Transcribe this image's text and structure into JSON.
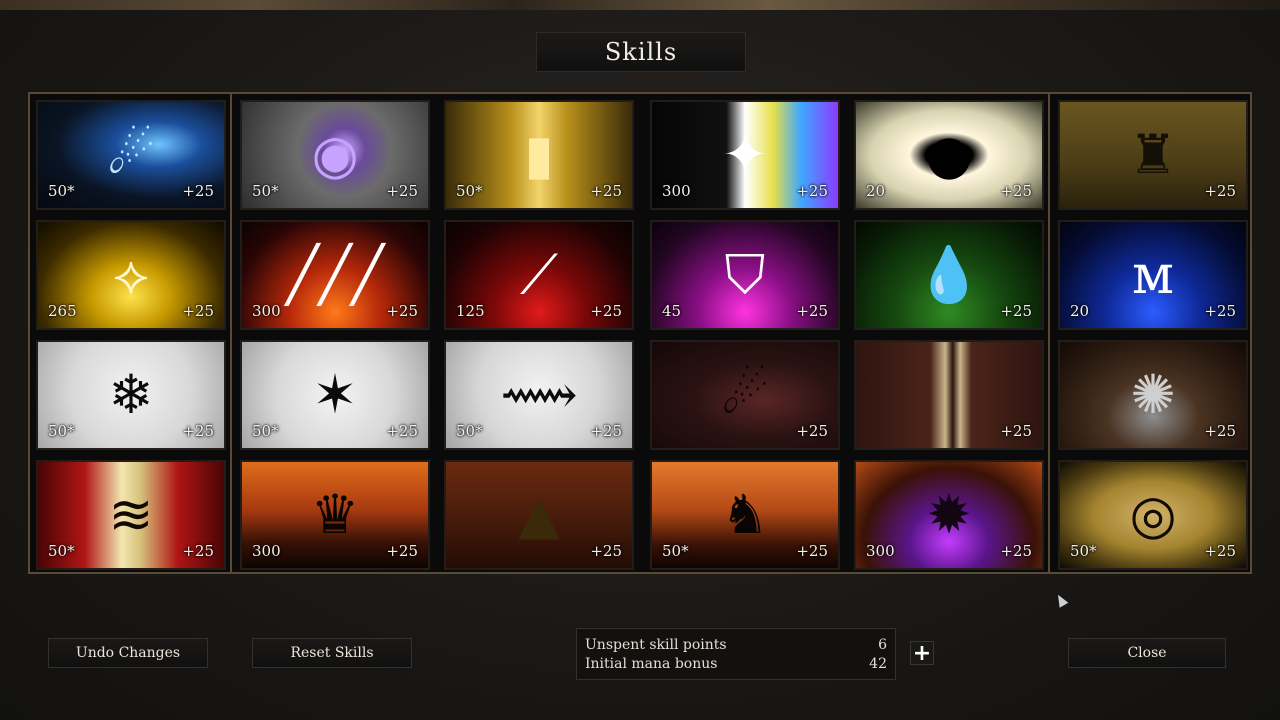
{
  "title": "Skills",
  "skills": [
    {
      "id": "r1c1",
      "cost": "50*",
      "bonus": "+25",
      "icon": "blue-comet-icon",
      "bg": "radial-gradient(ellipse at 65% 40%, #6fc4ff 0%, #1b4f9c 25%, #0a1424 60%, #05080f 100%)",
      "glyph": "☄",
      "glyphColor": "#bfe6ff"
    },
    {
      "id": "r1c2",
      "cost": "50*",
      "bonus": "+25",
      "icon": "crystal-orb-forest-icon",
      "bg": "radial-gradient(circle at 55% 45%, #c9a6ff 0%, #6a4a9c 18%, #6b6b6b 40%, #2e2e2e 100%)",
      "glyph": "◉",
      "glyphColor": "#c7a2ff"
    },
    {
      "id": "r1c3",
      "cost": "50*",
      "bonus": "+25",
      "icon": "golden-pillar-icon",
      "bg": "linear-gradient(90deg, #3a2b08 0%, #b8901c 35%, #f2d46a 50%, #b8901c 65%, #3a2b08 100%)",
      "glyph": "▮",
      "glyphColor": "#ffeaa0"
    },
    {
      "id": "r1c4",
      "cost": "300",
      "bonus": "+25",
      "icon": "prism-light-icon",
      "bg": "linear-gradient(90deg, #050505 0%, #101010 40%, #ffffff 50%, #e7e04a 65%, #3fa8ff 80%, #8a3bff 100%)",
      "glyph": "✦",
      "glyphColor": "#ffffff"
    },
    {
      "id": "r1c5",
      "cost": "20",
      "bonus": "+25",
      "icon": "dark-eclipse-icon",
      "bg": "radial-gradient(ellipse at 50% 50%, #000 0%, #000 18%, #fff7de 30%, #d7d2b0 60%, #3a3a2a 100%)",
      "glyph": "●",
      "glyphColor": "#000000"
    },
    {
      "id": "r1c6",
      "cost": "",
      "bonus": "+25",
      "icon": "crumbling-tower-icon",
      "bg": "linear-gradient(180deg, #6a5620 0%, #4b3c16 60%, #2a220d 100%)",
      "glyph": "♜",
      "glyphColor": "#141008"
    },
    {
      "id": "r2c1",
      "cost": "265",
      "bonus": "+25",
      "icon": "triple-arrows-icon",
      "bg": "radial-gradient(ellipse at 50% 70%, #ffe24d 0%, #c79a00 30%, #3b2a00 70%, #100b00 100%)",
      "glyph": "⟡",
      "glyphColor": "#fff8d0"
    },
    {
      "id": "r2c2",
      "cost": "300",
      "bonus": "+25",
      "icon": "claw-marks-icon",
      "bg": "radial-gradient(ellipse at 50% 85%, #ff7a1a 0%, #b6280a 35%, #2a0505 75%, #0c0202 100%)",
      "glyph": "╱╱╱",
      "glyphColor": "#ffffff"
    },
    {
      "id": "r2c3",
      "cost": "125",
      "bonus": "+25",
      "icon": "shattered-blade-icon",
      "bg": "radial-gradient(ellipse at 50% 85%, #e11a1a 0%, #7a0808 35%, #1f0303 75%, #0a0101 100%)",
      "glyph": "⟋",
      "glyphColor": "#ffffff"
    },
    {
      "id": "r2c4",
      "cost": "45",
      "bonus": "+25",
      "icon": "broken-shield-icon",
      "bg": "radial-gradient(ellipse at 50% 85%, #ff33e0 0%, #8a0f86 35%, #220622 75%, #0b020b 100%)",
      "glyph": "⛉",
      "glyphColor": "#ffffff"
    },
    {
      "id": "r2c5",
      "cost": "",
      "bonus": "+25",
      "icon": "poison-drops-icon",
      "bg": "radial-gradient(ellipse at 50% 85%, #2f8a22 0%, #164a10 40%, #071a05 80%, #030a02 100%)",
      "glyph": "💧",
      "glyphColor": "#7fbf6a"
    },
    {
      "id": "r2c6",
      "cost": "20",
      "bonus": "+25",
      "icon": "ice-fangs-icon",
      "bg": "radial-gradient(ellipse at 50% 85%, #2c5dff 0%, #0f2a9a 35%, #040c33 75%, #02040f 100%)",
      "glyph": "ᴍ",
      "glyphColor": "#ffffff"
    },
    {
      "id": "r3c1",
      "cost": "50*",
      "bonus": "+25",
      "icon": "snowflake-icon",
      "bg": "radial-gradient(circle at 50% 45%, #f2f2f2 0%, #d8d8d8 55%, #a8a8a8 100%)",
      "glyph": "❄",
      "glyphColor": "#0b0b0b"
    },
    {
      "id": "r3c2",
      "cost": "50*",
      "bonus": "+25",
      "icon": "star-burst-icon",
      "bg": "radial-gradient(circle at 50% 50%, #f4f4f4 0%, #d8d8d8 55%, #a6a6a6 100%)",
      "glyph": "✶",
      "glyphColor": "#0b0b0b"
    },
    {
      "id": "r3c3",
      "cost": "50*",
      "bonus": "+25",
      "icon": "slash-streaks-icon",
      "bg": "radial-gradient(circle at 50% 45%, #f2f2f2 0%, #d6d6d6 55%, #a4a4a4 100%)",
      "glyph": "⟿",
      "glyphColor": "#0b0b0b"
    },
    {
      "id": "r3c4",
      "cost": "",
      "bonus": "+25",
      "icon": "falling-meteor-icon",
      "bg": "radial-gradient(ellipse at 60% 55%, #5a2626 0%, #2b1212 45%, #140808 100%)",
      "glyph": "☄",
      "glyphColor": "#0f0606"
    },
    {
      "id": "r3c5",
      "cost": "",
      "bonus": "+25",
      "icon": "pillar-beam-icon",
      "bg": "linear-gradient(90deg, #2e1410 0%, #4a241a 40%, #c8b48a 48%, #2a1410 52%, #c8b48a 56%, #4a241a 62%, #2e1410 100%)",
      "glyph": "",
      "glyphColor": "#ffffff"
    },
    {
      "id": "r3c6",
      "cost": "",
      "bonus": "+25",
      "icon": "impact-splash-icon",
      "bg": "radial-gradient(ellipse at 50% 70%, #8e8e8e 0%, #4a3322 35%, #2a1a10 70%, #120a05 100%)",
      "glyph": "✺",
      "glyphColor": "#cfcfcf"
    },
    {
      "id": "r4c1",
      "cost": "50*",
      "bonus": "+25",
      "icon": "tiger-stripes-icon",
      "bg": "linear-gradient(90deg, #4a0505 0%, #b01515 25%, #f2e6b0 45%, #d6c27c 55%, #b01515 75%, #4a0505 100%)",
      "glyph": "≋",
      "glyphColor": "#120a02"
    },
    {
      "id": "r4c2",
      "cost": "300",
      "bonus": "+25",
      "icon": "dark-spire-icon",
      "bg": "linear-gradient(180deg, #e06c1c 0%, #a83a10 45%, #3a1206 75%, #0d0402 100%)",
      "glyph": "♛",
      "glyphColor": "#0a0503"
    },
    {
      "id": "r4c3",
      "cost": "",
      "bonus": "+25",
      "icon": "shadow-obelisk-icon",
      "bg": "linear-gradient(180deg, #6a2a10 0%, #4a1c0b 50%, #220c05 100%)",
      "glyph": "▲",
      "glyphColor": "#3a2a0a"
    },
    {
      "id": "r4c4",
      "cost": "50*",
      "bonus": "+25",
      "icon": "horned-lord-icon",
      "bg": "linear-gradient(180deg, #e47a2c 0%, #b44a16 45%, #3a1206 78%, #0d0402 100%)",
      "glyph": "♞",
      "glyphColor": "#0a0503"
    },
    {
      "id": "r4c5",
      "cost": "300",
      "bonus": "+25",
      "icon": "void-maw-icon",
      "bg": "radial-gradient(ellipse at 50% 75%, #c43cff 0%, #5a158a 30%, #3a1206 65%, #b24a16 100%)",
      "glyph": "✹",
      "glyphColor": "#120612"
    },
    {
      "id": "r4c6",
      "cost": "50*",
      "bonus": "+25",
      "icon": "golden-eye-icon",
      "bg": "radial-gradient(ellipse at 50% 50%, #d2b36a 0%, #a4842f 45%, #4a3a10 75%, #0f0b04 100%)",
      "glyph": "◎",
      "glyphColor": "#120b02"
    }
  ],
  "buttons": {
    "undo": "Undo Changes",
    "reset": "Reset Skills",
    "close": "Close"
  },
  "points": {
    "unspent_label": "Unspent skill points",
    "unspent_value": "6",
    "mana_label": "Initial mana bonus",
    "mana_value": "42",
    "plus_label": "+"
  }
}
